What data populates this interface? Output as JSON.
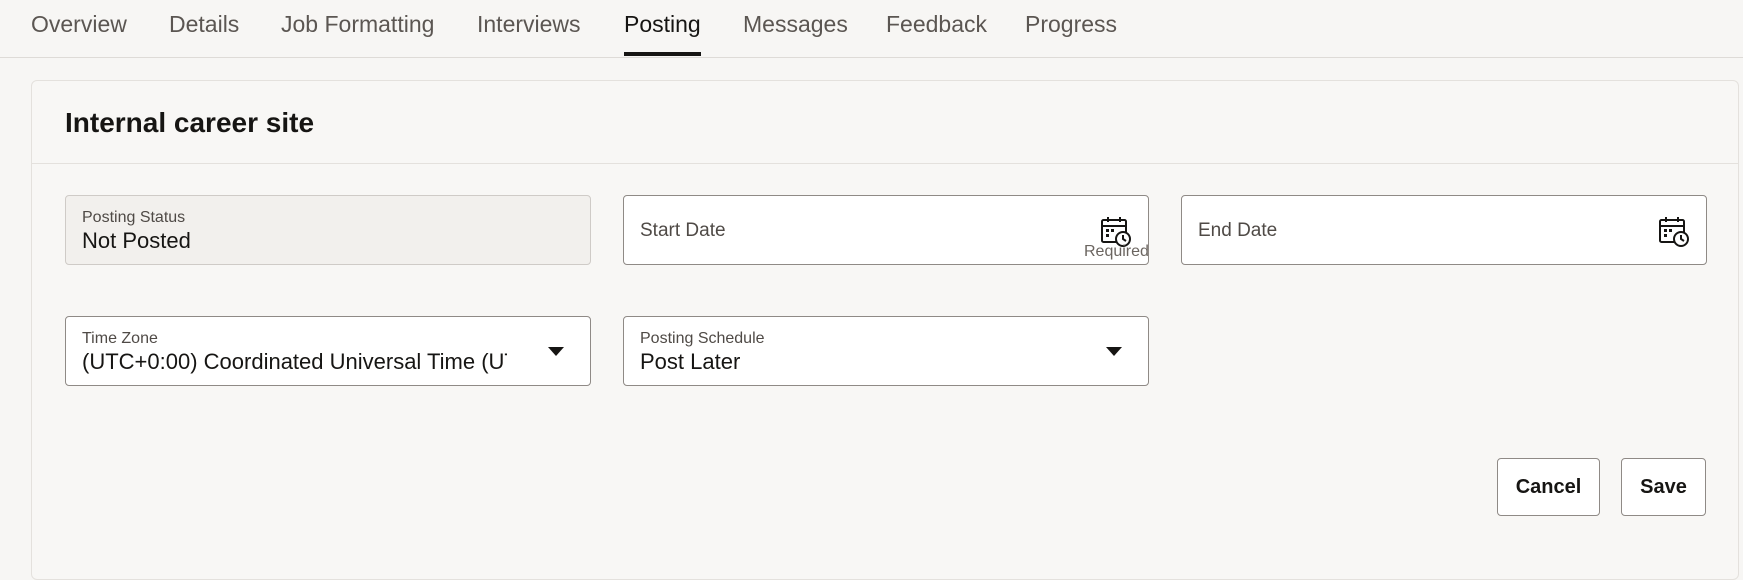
{
  "tabs": [
    {
      "label": "Overview"
    },
    {
      "label": "Details"
    },
    {
      "label": "Job Formatting"
    },
    {
      "label": "Interviews"
    },
    {
      "label": "Posting"
    },
    {
      "label": "Messages"
    },
    {
      "label": "Feedback"
    },
    {
      "label": "Progress"
    }
  ],
  "active_tab": "Posting",
  "card": {
    "title": "Internal career site",
    "posting_status": {
      "label": "Posting Status",
      "value": "Not Posted"
    },
    "start_date": {
      "placeholder": "Start Date",
      "helper": "Required",
      "icon": "calendar-clock-icon"
    },
    "end_date": {
      "placeholder": "End Date",
      "icon": "calendar-clock-icon"
    },
    "time_zone": {
      "label": "Time Zone",
      "value": "(UTC+0:00) Coordinated Universal Time (UT",
      "icon": "chevron-down-icon"
    },
    "posting_schedule": {
      "label": "Posting Schedule",
      "value": "Post Later",
      "icon": "chevron-down-icon"
    },
    "buttons": {
      "cancel": "Cancel",
      "save": "Save"
    }
  }
}
